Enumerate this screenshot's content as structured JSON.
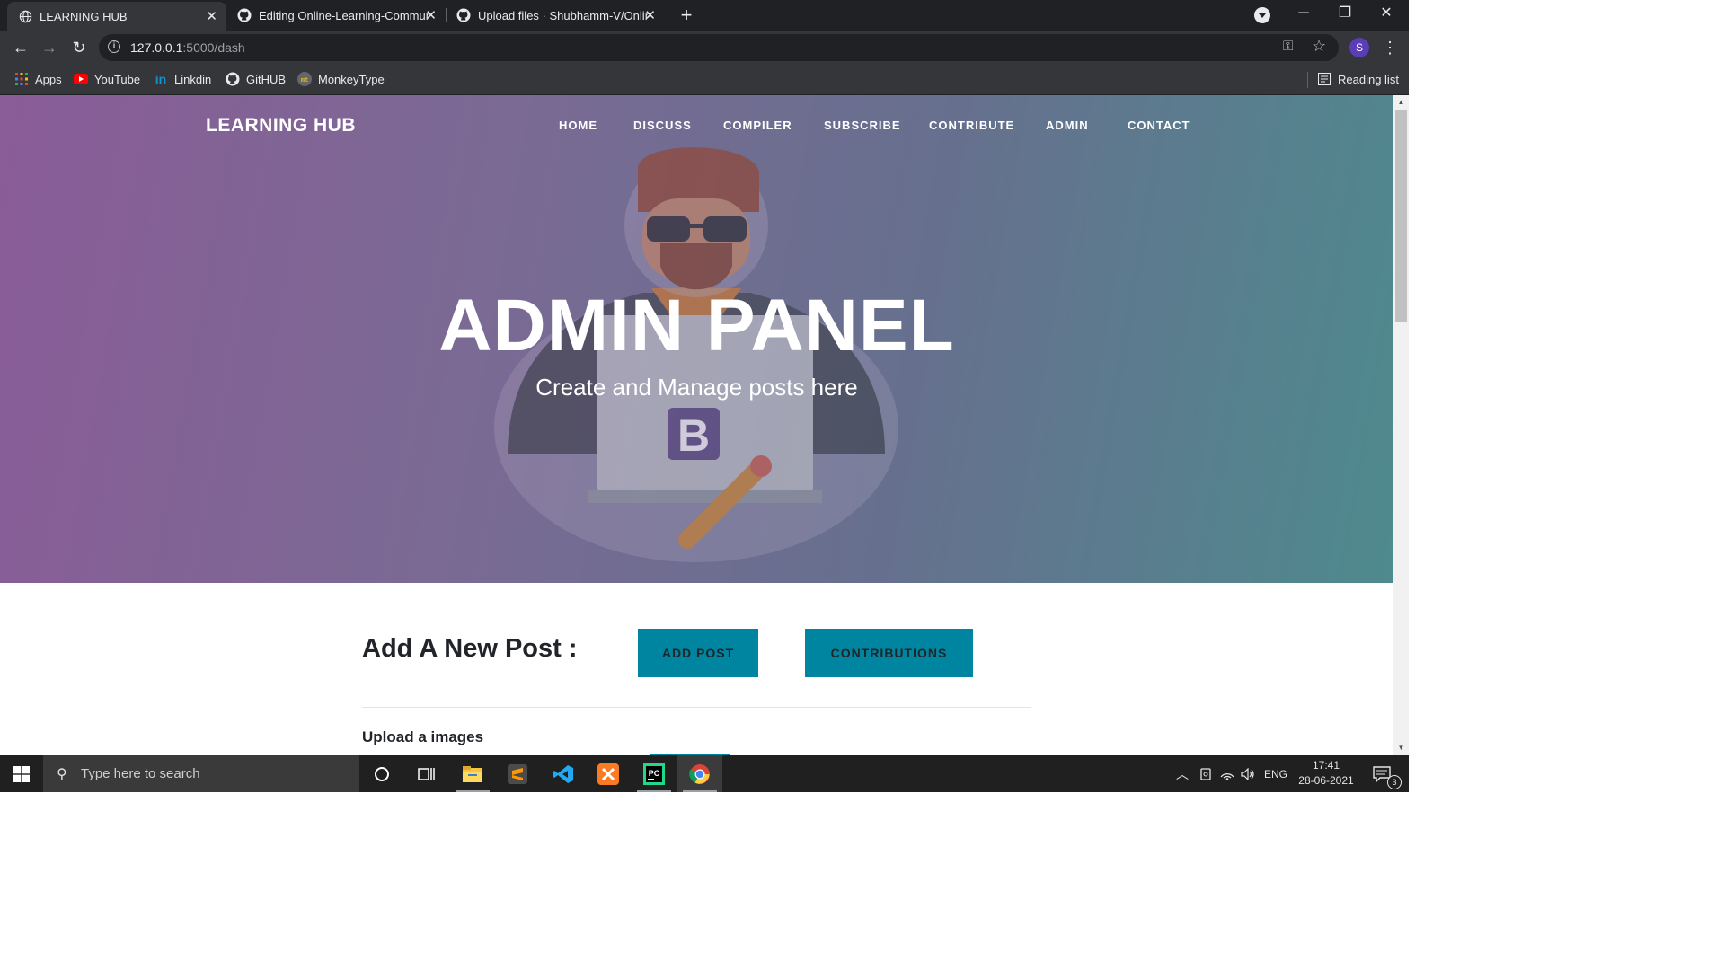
{
  "browser": {
    "tabs": [
      {
        "title": "LEARNING HUB",
        "icon": "globe-icon",
        "active": true
      },
      {
        "title": "Editing Online-Learning-Commun",
        "icon": "github-icon",
        "active": false
      },
      {
        "title": "Upload files · Shubhamm-V/Onlin",
        "icon": "github-icon",
        "active": false
      }
    ],
    "url_host": "127.0.0.1",
    "url_path": ":5000/dash",
    "profile_initial": "S",
    "bookmarks": [
      {
        "label": "Apps",
        "icon": "apps-grid-icon"
      },
      {
        "label": "YouTube",
        "icon": "youtube-icon"
      },
      {
        "label": "Linkdin",
        "icon": "linkedin-icon"
      },
      {
        "label": "GitHUB",
        "icon": "github-icon"
      },
      {
        "label": "MonkeyType",
        "icon": "monkeytype-icon"
      }
    ],
    "reading_list": "Reading list"
  },
  "site": {
    "brand": "LEARNING HUB",
    "nav": [
      "HOME",
      "DISCUSS",
      "COMPILER",
      "SUBSCRIBE",
      "CONTRIBUTE",
      "ADMIN",
      "CONTACT"
    ],
    "hero_title": "ADMIN PANEL",
    "hero_subtitle": "Create and Manage posts here",
    "hero_badge": "B",
    "colors": {
      "accent": "#0085a1",
      "hero_start": "#8a5c98",
      "hero_end": "#4e8a8e"
    }
  },
  "admin": {
    "add_heading": "Add A New Post :",
    "add_post_button": "ADD POST",
    "contributions_button": "CONTRIBUTIONS",
    "upload_label": "Upload a images"
  },
  "taskbar": {
    "search_placeholder": "Type here to search",
    "apps": [
      "cortana-icon",
      "task-view-icon",
      "file-explorer-icon",
      "sublime-text-icon",
      "vscode-icon",
      "xampp-icon",
      "pycharm-icon",
      "chrome-icon"
    ],
    "language": "ENG",
    "time": "17:41",
    "date": "28-06-2021",
    "notification_count": "3"
  }
}
